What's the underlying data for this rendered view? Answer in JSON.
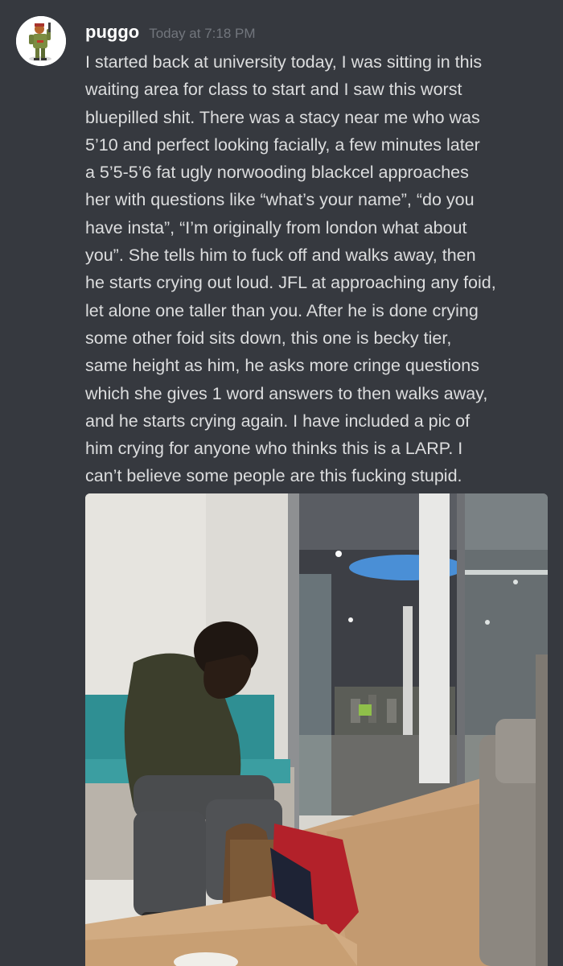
{
  "message": {
    "author": "puggo",
    "timestamp": "Today at 7:18 PM",
    "lines": [
      "I started back at university today, I was sitting in this",
      "waiting area for class to start and I saw this worst",
      "bluepilled shit. There was a stacy near me who was",
      "5’10 and perfect looking facially, a few minutes later",
      "a 5’5-5’6 fat ugly norwooding blackcel approaches",
      "her with questions like “what’s your name”, “do you",
      "have insta”, “I’m originally from london what about",
      "you”. She tells him to fuck off and walks away, then",
      "he starts crying out loud. JFL at approaching any foid,",
      "let alone one taller than you. After he is done crying",
      "some other foid sits down, this one is becky tier,",
      "same height as him, he asks more cringe questions",
      "which she gives 1 word answers to then walks away,",
      "and he starts crying again. I have included a pic of",
      "him crying for anyone who thinks this is a LARP. I",
      "can’t believe some people are this fucking stupid."
    ]
  },
  "colors": {
    "background": "#36393f",
    "username": "#ffffff",
    "timestamp": "#72767d",
    "text": "#dcddde"
  },
  "icons": {
    "avatar": "avatar-illustration"
  }
}
